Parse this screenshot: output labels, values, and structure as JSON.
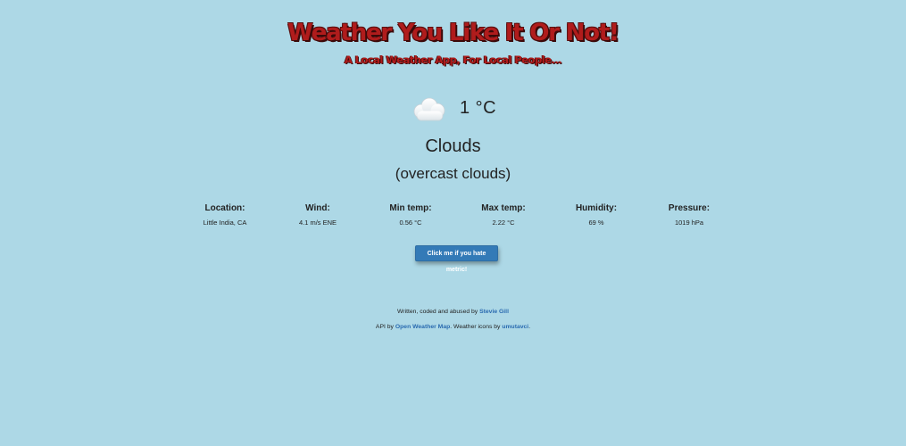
{
  "header": {
    "title": "Weather You Like It Or Not!",
    "subtitle": "A Local Weather App, For Local People..."
  },
  "current": {
    "icon": "cloud-icon",
    "temperature": "1 °C",
    "condition": "Clouds",
    "description": "(overcast clouds)"
  },
  "stats": [
    {
      "label": "Location:",
      "value": "Little India, CA"
    },
    {
      "label": "Wind:",
      "value": "4.1 m/s ENE"
    },
    {
      "label": "Min temp:",
      "value": "0.56 °C"
    },
    {
      "label": "Max temp:",
      "value": "2.22 °C"
    },
    {
      "label": "Humidity:",
      "value": "69 %"
    },
    {
      "label": "Pressure:",
      "value": "1019 hPa"
    }
  ],
  "button": {
    "label": "Click me if you hate metric!"
  },
  "footer": {
    "line1_prefix": "Written, coded and abused by ",
    "author_link": "Stevie Gill",
    "line2_prefix": "API by ",
    "api_link": "Open Weather Map",
    "line2_middle": ". Weather icons by ",
    "icons_link": "umutavci",
    "line2_suffix": "."
  },
  "colors": {
    "background": "#add8e6",
    "title_red": "#b01c1c",
    "button_blue": "#337ab7",
    "link_blue": "#2a6bb0"
  }
}
